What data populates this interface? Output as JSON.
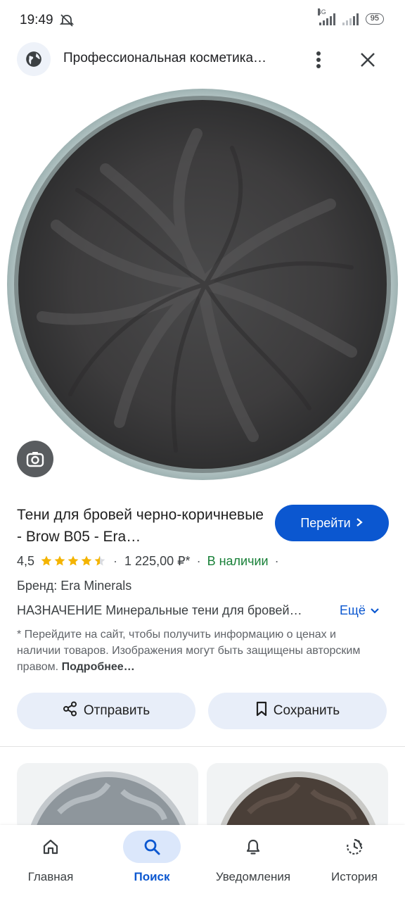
{
  "status_bar": {
    "time": "19:49",
    "network": "4G",
    "battery": "95"
  },
  "header": {
    "title": "Профессиональная косметика…",
    "icons": [
      "globe-icon",
      "more-vert-icon",
      "close-icon"
    ]
  },
  "image": {
    "lens_icon": "google-lens-icon"
  },
  "product": {
    "title": "Тени для бровей черно-коричневые - Brow B05 - Era…",
    "go_label": "Перейти",
    "rating": "4,5",
    "rating_value": 4.5,
    "rating_max": 5,
    "price": "1 225,00 ₽*",
    "separator": "·",
    "availability": "В наличии",
    "brand": "Бренд: Era Minerals",
    "description": "НАЗНАЧЕНИЕ Минеральные тени для бровей…",
    "more_label": "Ещё",
    "disclaimer": "* Перейдите на сайт, чтобы получить информацию о ценах и наличии товаров. Изображения могут быть защищены авторским правом.",
    "disclaimer_link": "Подробнее…"
  },
  "actions": {
    "share_label": "Отправить",
    "save_label": "Сохранить"
  },
  "bottom_nav": {
    "items": [
      {
        "label": "Главная",
        "icon": "home-icon"
      },
      {
        "label": "Поиск",
        "icon": "search-icon",
        "active": true
      },
      {
        "label": "Уведомления",
        "icon": "bell-icon"
      },
      {
        "label": "История",
        "icon": "history-icon"
      }
    ]
  },
  "colors": {
    "accent": "#0b57d0",
    "available": "#188038",
    "star": "#f4b400"
  }
}
